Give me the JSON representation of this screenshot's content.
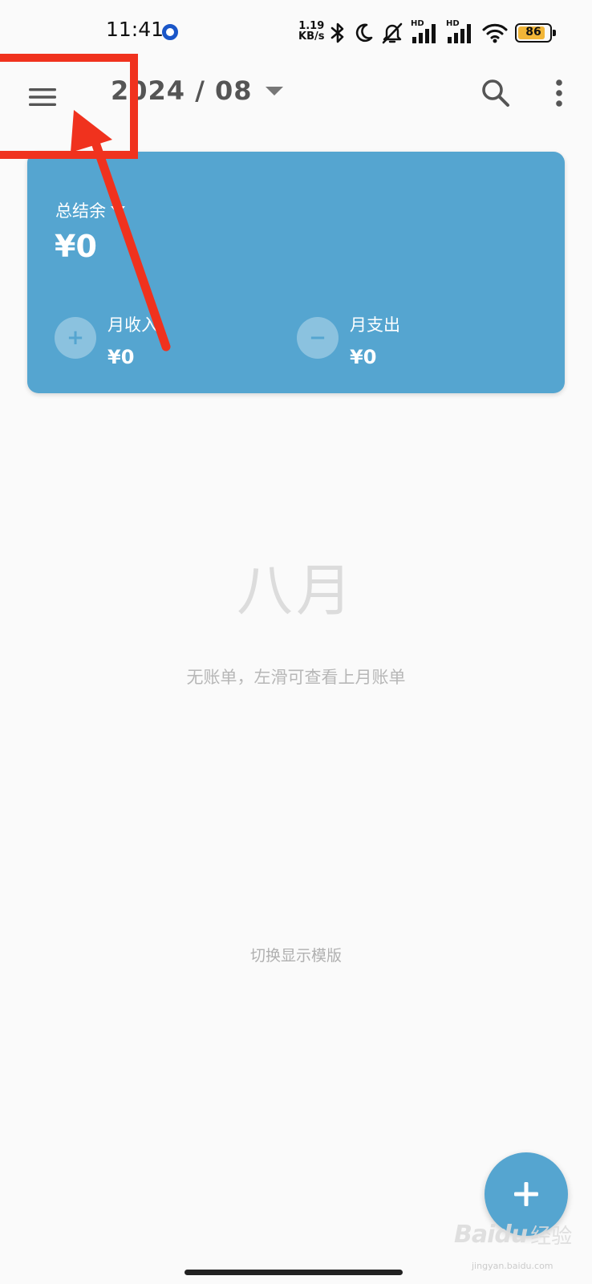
{
  "status_bar": {
    "time": "11:41",
    "net_speed_value": "1.19",
    "net_speed_unit": "KB/s",
    "signal_label_1": "HD",
    "signal_label_2": "HD",
    "battery_percent": 86,
    "battery_label": "86",
    "battery_color": "#f2b637"
  },
  "app_bar": {
    "month_label": "2024 / 08",
    "menu_icon": "hamburger-menu-icon",
    "search_icon": "search-icon",
    "more_icon": "more-vertical-icon"
  },
  "balance_card": {
    "label": "总结余",
    "amount": "¥0",
    "income": {
      "label": "月收入",
      "value": "¥0",
      "icon": "+"
    },
    "expense": {
      "label": "月支出",
      "value": "¥0",
      "icon": "−"
    },
    "color": "#55a5d0"
  },
  "empty_state": {
    "title": "八月",
    "hint": "无账单，左滑可查看上月账单"
  },
  "switch_template_label": "切换显示模版",
  "fab_icon": "plus-icon",
  "watermark": {
    "brand": "Baidu",
    "brand_cn": "经验",
    "url": "jingyan.baidu.com"
  },
  "annotation_color": "#f0321e"
}
